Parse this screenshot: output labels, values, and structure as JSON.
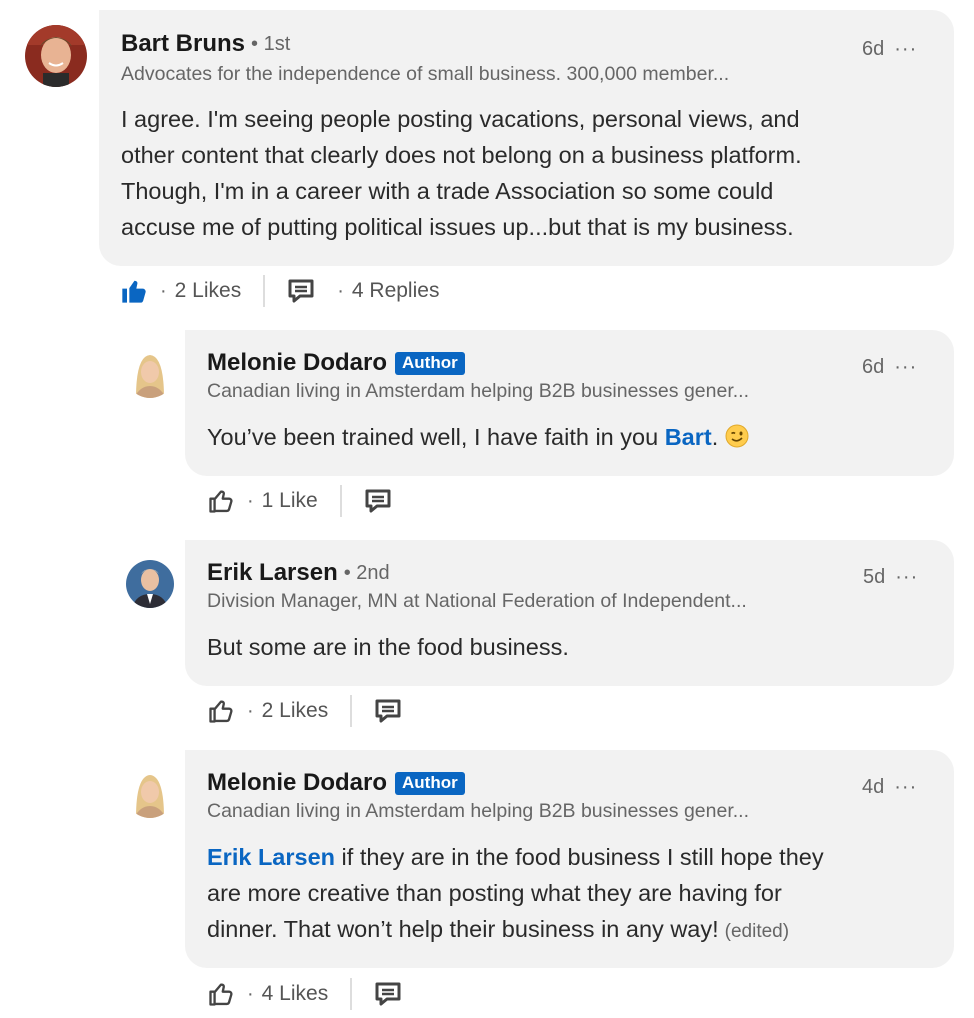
{
  "comments": [
    {
      "name": "Bart Bruns",
      "degree": "• 1st",
      "headline": "Advocates for the independence of small business. 300,000 member...",
      "time": "6d",
      "menu": "···",
      "text_lines": [
        "I agree. I'm seeing people posting vacations, personal views, and",
        "other content that clearly does not belong on a business platform.",
        "Though, I'm in a career with a trade Association so some could",
        "accuse me of putting political issues up...but that is my business."
      ],
      "likes": "2 Likes",
      "replies": "4 Replies",
      "sep": "·",
      "liked": true
    }
  ],
  "replies": [
    {
      "name": "Melonie Dodaro",
      "badge": "Author",
      "headline": "Canadian living in Amsterdam helping B2B businesses gener...",
      "time": "6d",
      "menu": "···",
      "text_before": "You’ve been trained well, I have faith in you ",
      "mention": "Bart",
      "text_after": ". ",
      "emoji": "winking-face",
      "likes": "1 Like",
      "sep": "·"
    },
    {
      "name": "Erik Larsen",
      "degree": "• 2nd",
      "headline": "Division Manager, MN at National Federation of Independent...",
      "time": "5d",
      "menu": "···",
      "text": "But some are in the food business.",
      "likes": "2 Likes",
      "sep": "·"
    },
    {
      "name": "Melonie Dodaro",
      "badge": "Author",
      "headline": "Canadian living in Amsterdam helping B2B businesses gener...",
      "time": "4d",
      "menu": "···",
      "mention": "Erik Larsen",
      "text_line1_after": " if they are in the food business I still hope they",
      "text_line2": "are more creative than posting what they are having for",
      "text_line3": "dinner. That won’t help their business in any way!",
      "edited": "(edited)",
      "likes": "4 Likes",
      "sep": "·"
    }
  ],
  "colors": {
    "accent": "#0a66c2",
    "bubble": "#f2f2f2",
    "muted": "#666666"
  }
}
